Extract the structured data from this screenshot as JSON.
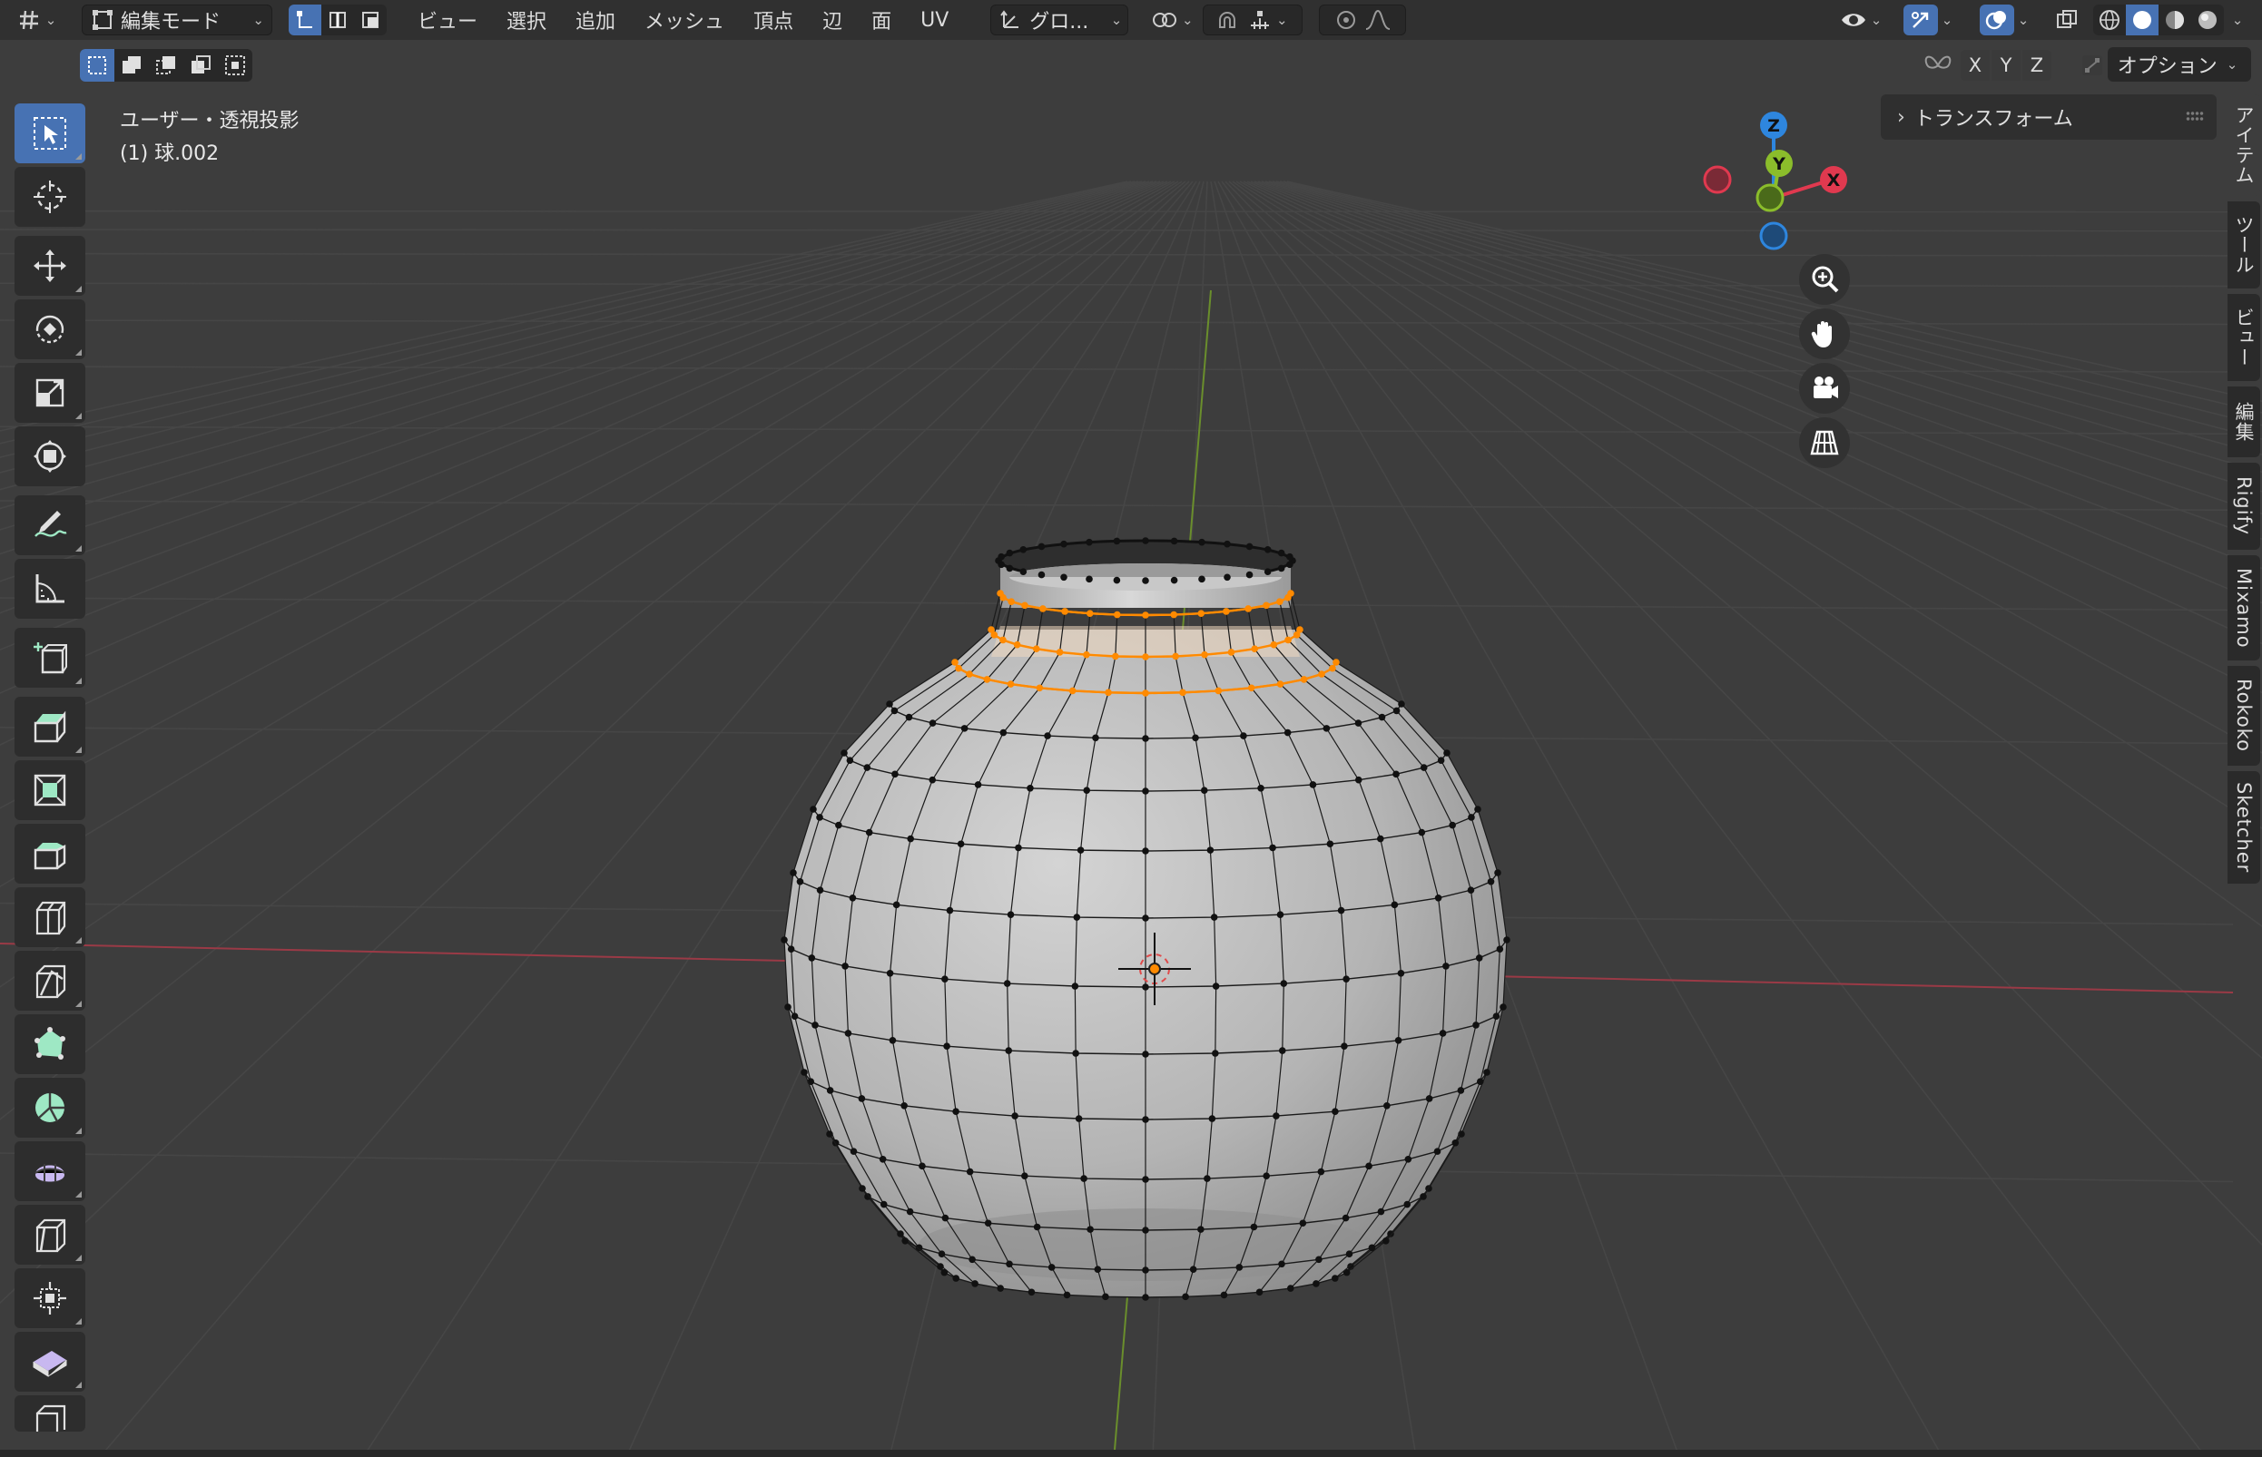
{
  "header": {
    "mode_label": "編集モード",
    "menu": [
      "ビュー",
      "選択",
      "追加",
      "メッシュ",
      "頂点",
      "辺",
      "面",
      "UV"
    ],
    "transform_orientation": "グロ..."
  },
  "subbar": {
    "axes": [
      "X",
      "Y",
      "Z"
    ],
    "options_label": "オプション"
  },
  "viewport": {
    "view_name": "ユーザー・透視投影",
    "object_name": "(1) 球.002",
    "gizmo_labels": {
      "z": "Z",
      "y": "Y",
      "x": "X"
    }
  },
  "npanel": {
    "section": "トランスフォーム",
    "tabs": [
      "アイテム",
      "ツール",
      "ビュー",
      "編集",
      "Rigify",
      "Mixamo",
      "Rokoko",
      "Sketcher"
    ]
  },
  "colors": {
    "accent": "#4772b3",
    "selected": "#ff8a00",
    "axis_x": "#e0394f",
    "axis_y": "#8bbd2b",
    "axis_z": "#2e86de",
    "tool_icon_green": "#9ee8c4"
  }
}
